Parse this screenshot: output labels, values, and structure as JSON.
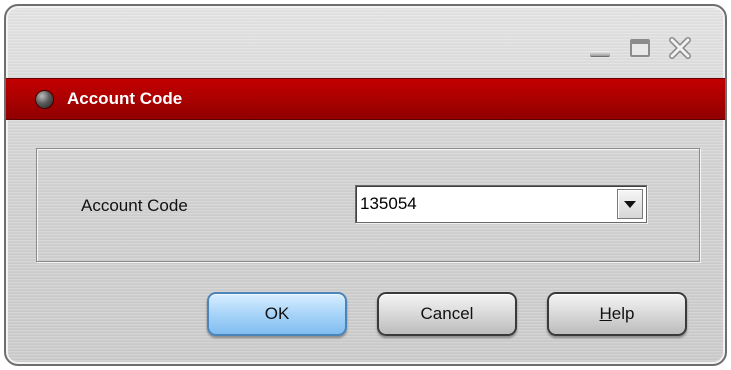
{
  "window": {
    "controls": {
      "minimize_icon": "minimize-icon",
      "maximize_icon": "maximize-icon",
      "close_icon": "close-icon"
    }
  },
  "banner": {
    "title": "Account Code",
    "bullet_icon": "bullet-icon",
    "color": "#a80000"
  },
  "form": {
    "account_code_label": "Account Code",
    "account_code_value": "135054",
    "dropdown_icon": "chevron-down-icon"
  },
  "buttons": {
    "ok_label": "OK",
    "cancel_label": "Cancel",
    "help_mnemonic": "H",
    "help_rest": "elp"
  },
  "colors": {
    "ok_button": "#a8d4f8",
    "banner": "#a80000"
  }
}
